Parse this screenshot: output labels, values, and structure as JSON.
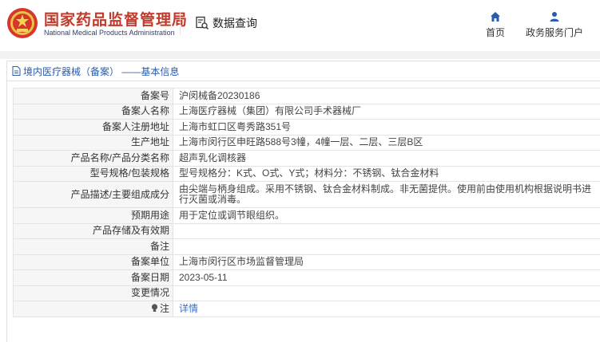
{
  "header": {
    "brand_cn": "国家药品监督管理局",
    "brand_en": "National Medical Products Administration",
    "query_label": "数据查询",
    "nav": [
      {
        "label": "首页",
        "icon": "home-icon"
      },
      {
        "label": "政务服务门户",
        "icon": "user-icon"
      }
    ]
  },
  "panel": {
    "title": "境内医疗器械（备案） ——基本信息"
  },
  "rows": [
    {
      "label": "备案号",
      "value": "沪闵械备20230186"
    },
    {
      "label": "备案人名称",
      "value": "上海医疗器械（集团）有限公司手术器械厂"
    },
    {
      "label": "备案人注册地址",
      "value": "上海市虹口区粤秀路351号"
    },
    {
      "label": "生产地址",
      "value": "上海市闵行区申旺路588号3幢，4幢一层、二层、三层B区"
    },
    {
      "label": "产品名称/产品分类名称",
      "value": "超声乳化调核器"
    },
    {
      "label": "型号规格/包装规格",
      "value": "型号规格分：K式、O式、Y式；材料分：不锈钢、钛合金材料"
    },
    {
      "label": "产品描述/主要组成成分",
      "value": "由尖端与柄身组成。采用不锈钢、钛合金材料制成。非无菌提供。使用前由使用机构根据说明书进行灭菌或消毒。"
    },
    {
      "label": "预期用途",
      "value": "用于定位或调节眼组织。"
    },
    {
      "label": "产品存储及有效期",
      "value": ""
    },
    {
      "label": "备注",
      "value": ""
    },
    {
      "label": "备案单位",
      "value": "上海市闵行区市场监督管理局"
    },
    {
      "label": "备案日期",
      "value": "2023-05-11"
    },
    {
      "label": "变更情况",
      "value": ""
    },
    {
      "label": "注",
      "value": "详情"
    }
  ],
  "colors": {
    "brand_red": "#c0392b",
    "title_blue": "#2a5bab",
    "link_blue": "#3a6fc4"
  }
}
